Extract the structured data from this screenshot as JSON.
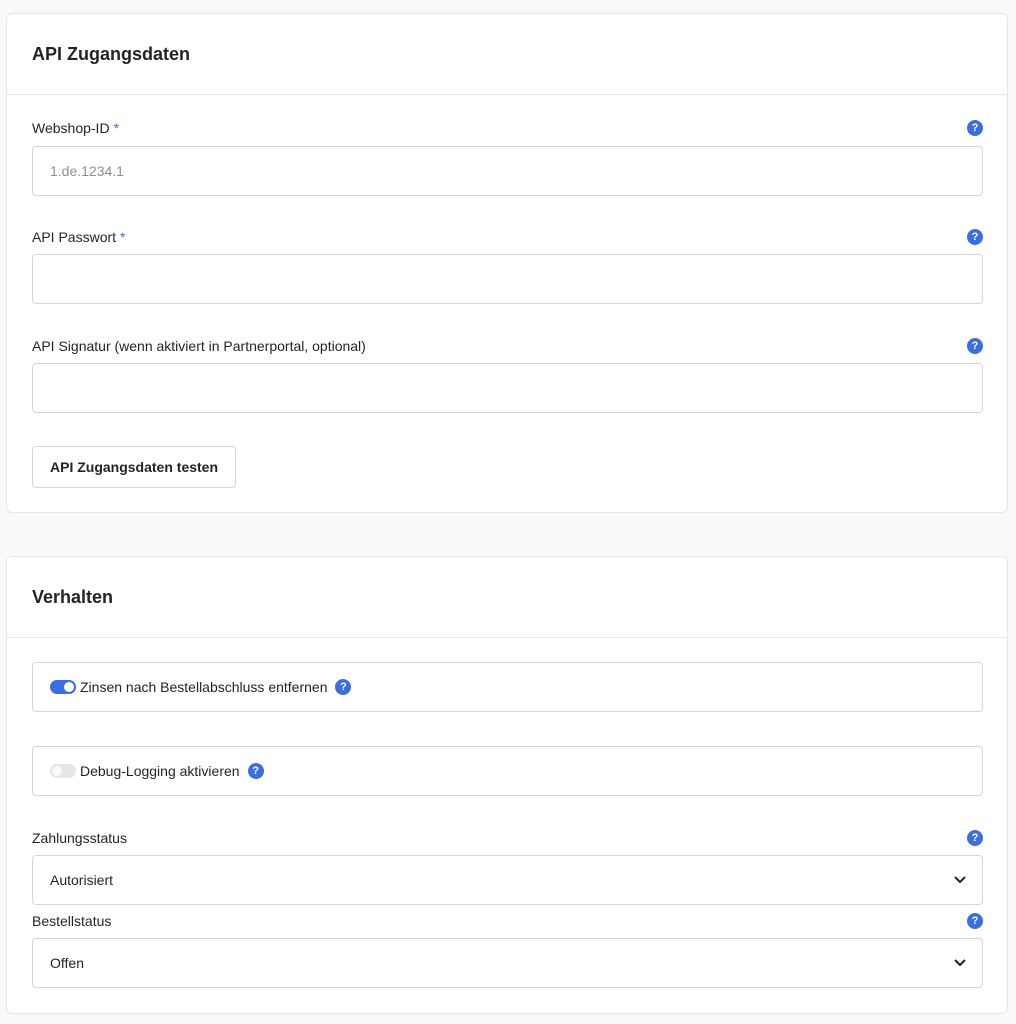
{
  "colors": {
    "accent": "#3b6fe0",
    "border": "#d3d7dc",
    "background": "#f8f9fb"
  },
  "api_section": {
    "title": "API Zugangsdaten",
    "webshop_id": {
      "label": "Webshop-ID",
      "required_mark": "*",
      "value": "",
      "placeholder": "1.de.1234.1",
      "help_icon": "question-circle-icon"
    },
    "api_password": {
      "label": "API Passwort",
      "required_mark": "*",
      "value": "",
      "placeholder": "",
      "help_icon": "question-circle-icon"
    },
    "api_signature": {
      "label": "API Signatur (wenn aktiviert in Partnerportal, optional)",
      "value": "",
      "placeholder": "",
      "help_icon": "question-circle-icon"
    },
    "test_button_label": "API Zugangsdaten testen"
  },
  "behavior_section": {
    "title": "Verhalten",
    "remove_interest": {
      "label": "Zinsen nach Bestellabschluss entfernen",
      "enabled": true
    },
    "debug_logging": {
      "label": "Debug-Logging aktivieren",
      "enabled": false
    },
    "payment_status": {
      "label": "Zahlungsstatus",
      "selected": "Autorisiert"
    },
    "order_status": {
      "label": "Bestellstatus",
      "selected": "Offen"
    }
  },
  "help_glyph": "?"
}
